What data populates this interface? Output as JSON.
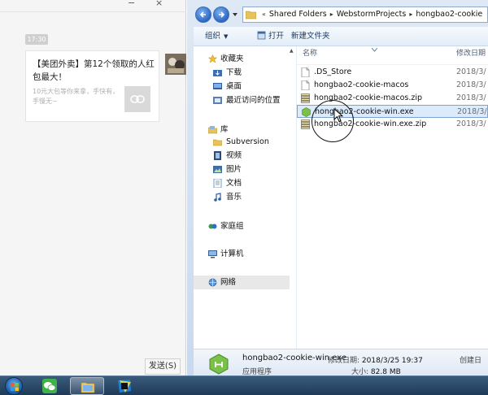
{
  "chat": {
    "time": "17:30",
    "card_title": "【美团外卖】第12个领取的人红包最大！",
    "card_desc": "10元大包等你来拿，手快有，手慢无~",
    "send_label": "发送(S)"
  },
  "explorer": {
    "breadcrumb": [
      "Shared Folders",
      "WebstormProjects",
      "hongbao2-cookie"
    ],
    "toolbar": {
      "organize": "组织",
      "open": "打开",
      "new_folder": "新建文件夹"
    },
    "nav": {
      "favorites": "收藏夹",
      "downloads": "下载",
      "desktop": "桌面",
      "recent": "最近访问的位置",
      "libraries": "库",
      "subversion": "Subversion",
      "videos": "视频",
      "pictures": "图片",
      "documents": "文档",
      "music": "音乐",
      "homegroup": "家庭组",
      "computer": "计算机",
      "network": "网络"
    },
    "columns": {
      "name": "名称",
      "modified": "修改日期"
    },
    "files": [
      {
        "name": ".DS_Store",
        "date": "2018/3/",
        "icon": "file-icon"
      },
      {
        "name": "hongbao2-cookie-macos",
        "date": "2018/3/",
        "icon": "file-icon"
      },
      {
        "name": "hongbao2-cookie-macos.zip",
        "date": "2018/3/",
        "icon": "zip-icon"
      },
      {
        "name": "hongbao2-cookie-win.exe",
        "date": "2018/3/",
        "icon": "exe-icon"
      },
      {
        "name": "hongbao2-cookie-win.exe.zip",
        "date": "2018/3/",
        "icon": "zip-icon"
      }
    ],
    "details": {
      "name": "hongbao2-cookie-win.exe",
      "type": "应用程序",
      "modified_label": "修改日期:",
      "modified_value": "2018/3/25 19:37",
      "size_label": "大小:",
      "size_value": "82.8 MB",
      "created_label": "创建日"
    }
  },
  "colors": {
    "accent": "#2b68c4",
    "selection": "#dcebfc",
    "taskbar": "#1f3a58"
  }
}
